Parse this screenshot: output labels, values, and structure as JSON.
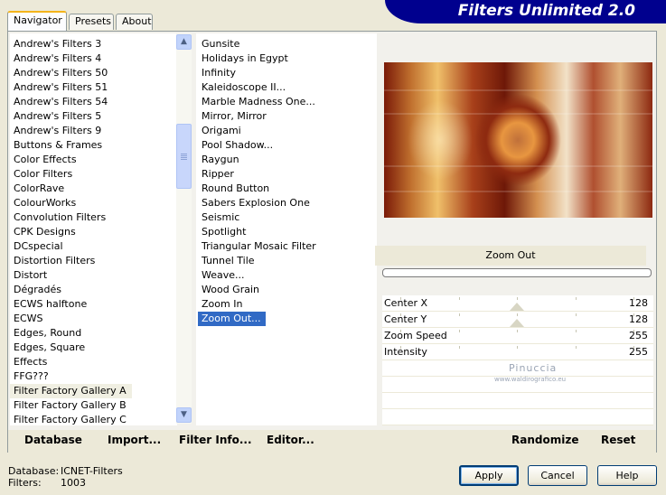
{
  "window": {
    "title": "Filters Unlimited 2.0"
  },
  "tabs": [
    {
      "label": "Navigator",
      "active": true
    },
    {
      "label": "Presets",
      "active": false
    },
    {
      "label": "About",
      "active": false
    }
  ],
  "categories": [
    "Andrew's Filters 3",
    "Andrew's Filters 4",
    "Andrew's Filters 50",
    "Andrew's Filters 51",
    "Andrew's Filters 54",
    "Andrew's Filters 5",
    "Andrew's Filters 9",
    "Buttons & Frames",
    "Color Effects",
    "Color Filters",
    "ColorRave",
    "ColourWorks",
    "Convolution Filters",
    "CPK Designs",
    "DCspecial",
    "Distortion Filters",
    "Distort",
    "Dégradés",
    "ECWS halftone",
    "ECWS",
    "Edges, Round",
    "Edges, Square",
    "Effects",
    "FFG???",
    "Filter Factory Gallery A",
    "Filter Factory Gallery B",
    "Filter Factory Gallery C"
  ],
  "selected_category": "Filter Factory Gallery A",
  "filters": [
    "Gunsite",
    "Holidays in Egypt",
    "Infinity",
    "Kaleidoscope II...",
    "Marble Madness One...",
    "Mirror, Mirror",
    "Origami",
    "Pool Shadow...",
    "Raygun",
    "Ripper",
    "Round Button",
    "Sabers Explosion One",
    "Seismic",
    "Spotlight",
    "Triangular Mosaic Filter",
    "Tunnel Tile",
    "Weave...",
    "Wood Grain",
    "Zoom In",
    "Zoom Out..."
  ],
  "selected_filter": "Zoom Out...",
  "filter_name": "Zoom Out",
  "parameters": [
    {
      "label": "Center X",
      "value": "128",
      "level": 0.5,
      "show_thumb": true
    },
    {
      "label": "Center Y",
      "value": "128",
      "level": 0.5,
      "show_thumb": true
    },
    {
      "label": "Zoom Speed",
      "value": "255",
      "level": 1.0,
      "show_thumb": false
    },
    {
      "label": "Intensity",
      "value": "255",
      "level": 1.0,
      "show_thumb": false
    }
  ],
  "watermark": {
    "line1": "Pinuccia",
    "line2": "www.waldirografico.eu"
  },
  "commands": {
    "database": "Database",
    "import": "Import...",
    "filter_info": "Filter Info...",
    "editor": "Editor...",
    "randomize": "Randomize",
    "reset": "Reset"
  },
  "footer": {
    "database_label": "Database:",
    "database_value": "ICNET-Filters",
    "filters_label": "Filters:",
    "filters_value": "1003"
  },
  "buttons": {
    "apply": "Apply",
    "cancel": "Cancel",
    "help": "Help"
  },
  "colors": {
    "banner": "#00008e",
    "selection": "#316ac5",
    "background": "#ece9d8"
  }
}
